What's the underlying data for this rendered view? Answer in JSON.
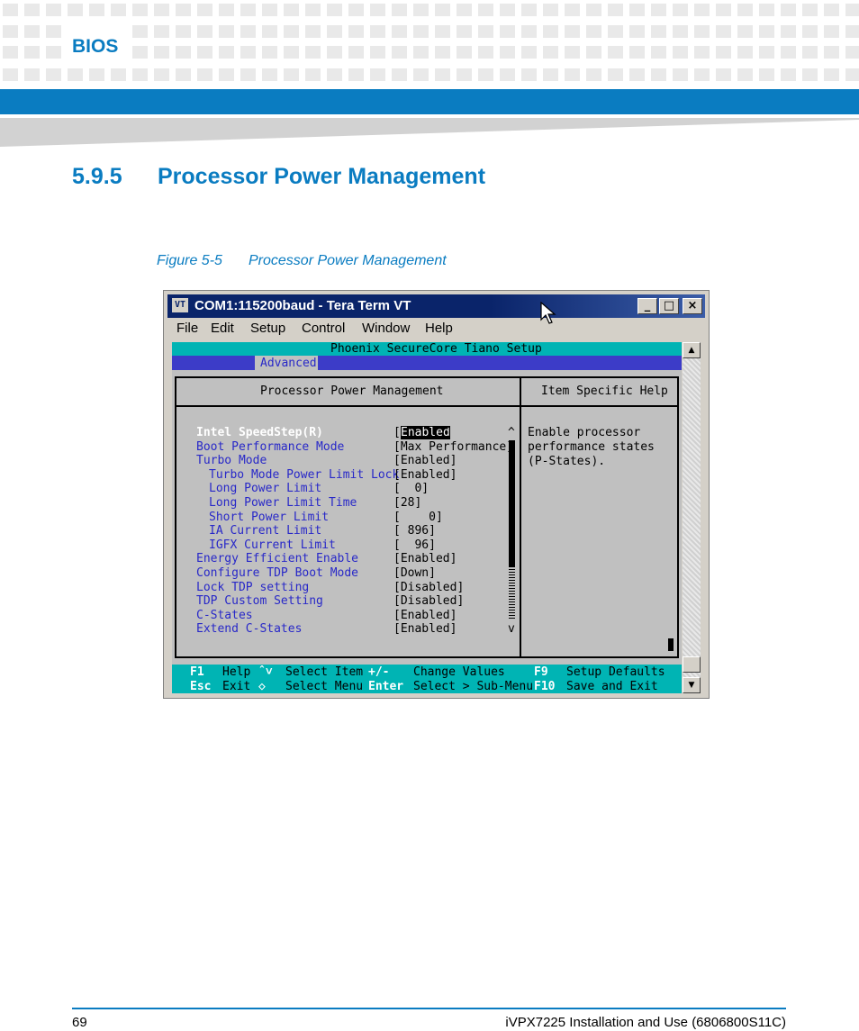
{
  "header": {
    "chapter_label": "BIOS",
    "section_number": "5.9.5",
    "section_title": "Processor Power Management"
  },
  "figure": {
    "label": "Figure 5-5",
    "caption": "Processor Power Management"
  },
  "window": {
    "icon_text": "VT",
    "title": "COM1:115200baud - Tera Term VT",
    "minimize": "_",
    "maximize": "□",
    "close": "×",
    "menu": [
      "File",
      "Edit",
      "Setup",
      "Control",
      "Window",
      "Help"
    ],
    "scroll_up": "▲",
    "scroll_down": "▼"
  },
  "bios": {
    "setup_title": "Phoenix SecureCore Tiano Setup",
    "active_tab": "Advanced",
    "panel_title": "Processor Power Management",
    "help_title": "Item Specific Help",
    "scroll_top": "^",
    "scroll_bottom": "v",
    "items": [
      {
        "label": "Intel SpeedStep(R)",
        "value": "Enabled",
        "selected": true,
        "indent": 0
      },
      {
        "label": "Boot Performance Mode",
        "value": "[Max Performance]",
        "indent": 0
      },
      {
        "label": "Turbo Mode",
        "value": "[Enabled]",
        "indent": 0
      },
      {
        "label": "Turbo Mode Power Limit Lock",
        "value": "[Enabled]",
        "indent": 1
      },
      {
        "label": "Long Power Limit",
        "value": "[  0]",
        "indent": 1
      },
      {
        "label": "Long Power Limit Time",
        "value": "[28]",
        "indent": 1
      },
      {
        "label": "Short Power Limit",
        "value": "[    0]",
        "indent": 1
      },
      {
        "label": "IA Current Limit",
        "value": "[ 896]",
        "indent": 1
      },
      {
        "label": "IGFX Current Limit",
        "value": "[  96]",
        "indent": 1
      },
      {
        "label": "Energy Efficient Enable",
        "value": "[Enabled]",
        "indent": 0
      },
      {
        "label": "Configure TDP Boot Mode",
        "value": "[Down]",
        "indent": 0
      },
      {
        "label": "Lock TDP setting",
        "value": "[Disabled]",
        "indent": 0
      },
      {
        "label": "TDP Custom Setting",
        "value": "[Disabled]",
        "indent": 0
      },
      {
        "label": "C-States",
        "value": "[Enabled]",
        "indent": 0
      },
      {
        "label": "Extend C-States",
        "value": "[Enabled]",
        "indent": 0
      }
    ],
    "help_lines": [
      "Enable processor",
      "performance states",
      "(P-States)."
    ],
    "keys": {
      "row1": [
        {
          "key": "F1",
          "desc": "Help"
        },
        {
          "key": "ˆ˅",
          "desc": "Select Item"
        },
        {
          "key": "+/-",
          "desc": "Change Values"
        },
        {
          "key": "F9",
          "desc": "Setup Defaults"
        }
      ],
      "row2": [
        {
          "key": "Esc",
          "desc": "Exit"
        },
        {
          "key": "◇",
          "desc": "Select Menu"
        },
        {
          "key": "Enter",
          "desc": "Select > Sub-Menu"
        },
        {
          "key": "F10",
          "desc": "Save and Exit"
        }
      ]
    }
  },
  "footer": {
    "page_number": "69",
    "document_title": "iVPX7225 Installation and Use (6806800S11C)"
  }
}
